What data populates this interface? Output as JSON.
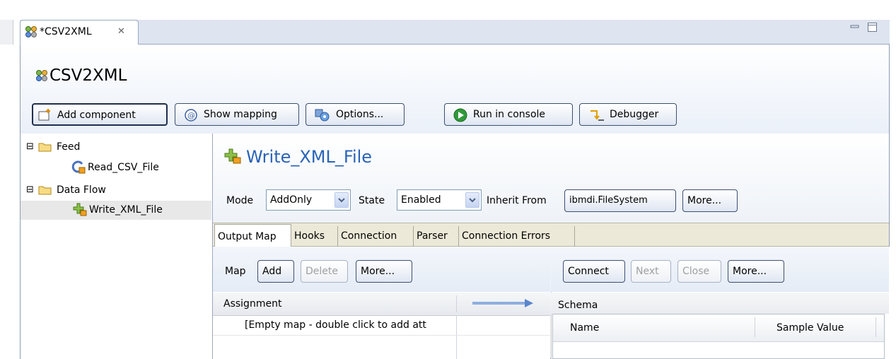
{
  "editor_tab": {
    "title": "*CSV2XML",
    "close_glyph": "✕"
  },
  "window_controls": {
    "minimize": "minimize-icon",
    "maximize": "maximize-icon"
  },
  "editor": {
    "title": "CSV2XML"
  },
  "toolbar": {
    "add_component": "Add component",
    "show_mapping": "Show mapping",
    "options": "Options...",
    "run_in_console": "Run in console",
    "debugger": "Debugger"
  },
  "tree": {
    "items": [
      {
        "label": "Feed",
        "expander": "⊟",
        "icon": "folder-icon",
        "level": 0
      },
      {
        "label": "Read_CSV_File",
        "icon": "iterator-connector-icon",
        "level": 1
      },
      {
        "label": "Data Flow",
        "expander": "⊟",
        "icon": "folder-icon",
        "level": 0
      },
      {
        "label": "Write_XML_File",
        "icon": "add-connector-icon",
        "level": 1,
        "selected": true
      }
    ]
  },
  "component": {
    "title": "Write_XML_File",
    "mode_label": "Mode",
    "mode_value": "AddOnly",
    "state_label": "State",
    "state_value": "Enabled",
    "inherit_label": "Inherit From",
    "inherit_value": "ibmdi.FileSystem",
    "more": "More..."
  },
  "tabs": [
    "Output Map",
    "Hooks",
    "Connection",
    "Parser",
    "Connection Errors"
  ],
  "map_toolbar": {
    "label": "Map",
    "add": "Add",
    "delete": "Delete",
    "more": "More..."
  },
  "assignment": {
    "header": "Assignment",
    "empty_row": "[Empty map - double click to add att"
  },
  "schema_toolbar": {
    "connect": "Connect",
    "next": "Next",
    "close": "Close",
    "more": "More..."
  },
  "schema": {
    "header": "Schema",
    "columns": [
      "Name",
      "Sample Value"
    ]
  },
  "colors": {
    "accent_title": "#2a63b8",
    "selection": "#e8e8e8",
    "tab_bar": "#ece9d8"
  }
}
